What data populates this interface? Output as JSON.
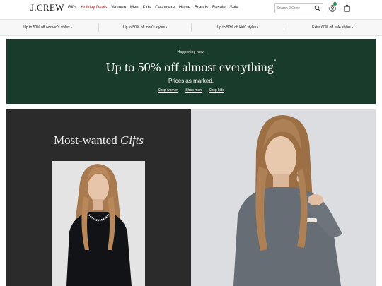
{
  "header": {
    "logo": "J.CREW",
    "nav": [
      {
        "label": "Gifts"
      },
      {
        "label": "Holiday Deals"
      },
      {
        "label": "Women"
      },
      {
        "label": "Men"
      },
      {
        "label": "Kids"
      },
      {
        "label": "Cashmere"
      },
      {
        "label": "Home"
      },
      {
        "label": "Brands"
      },
      {
        "label": "Resale"
      },
      {
        "label": "Sale"
      }
    ],
    "search_placeholder": "Search J.Crew",
    "account_badge": "✓",
    "icons": {
      "search": "search-icon",
      "account": "user-icon",
      "bag": "shopping-bag-icon"
    },
    "colors": {
      "holiday": "#b71c1c",
      "badge": "#1e8a4c"
    }
  },
  "promo_strip": [
    {
      "label": "Up to 50% off women's styles ›"
    },
    {
      "label": "Up to 50% off men's styles ›"
    },
    {
      "label": "Up to 50% off kids' styles ›"
    },
    {
      "label": "Extra 60% off sale styles ›"
    }
  ],
  "banner": {
    "eyebrow": "Happening now:",
    "headline": "Up to 50% off almost everything",
    "headline_mark": "*",
    "sub": "Prices as marked.",
    "links": [
      {
        "label": "Shop women"
      },
      {
        "label": "Shop men"
      },
      {
        "label": "Shop kids"
      }
    ],
    "color": "#183b2b"
  },
  "hero": {
    "title_plain": "Most-wanted ",
    "title_italic": "Gifts"
  }
}
